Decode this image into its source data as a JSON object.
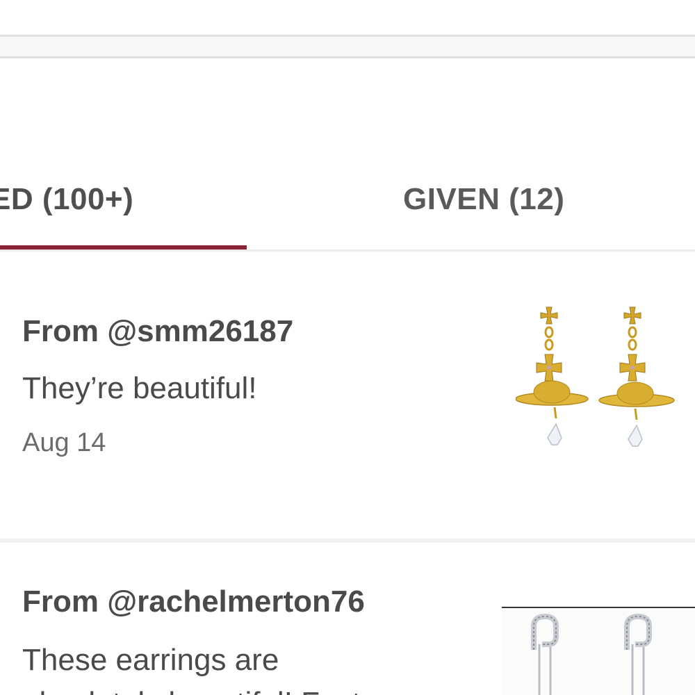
{
  "tabs": {
    "received_label": "ED (100+)",
    "given_label": "GIVEN (12)"
  },
  "reviews": [
    {
      "from": "From @smm26187",
      "text": "They’re beautiful!",
      "date": "Aug 14",
      "thumbnail": "gold-orb-drop-earrings"
    },
    {
      "from": "From @rachelmerton76",
      "text": "These earrings are",
      "text_cont": "absolutely beautiful! Fast",
      "thumbnail": "crystal-safety-pin-earrings"
    }
  ],
  "colors": {
    "accent": "#8b2338",
    "text": "#4a4a4a",
    "muted": "#6b6b6b",
    "gold": "#d4a72c"
  }
}
